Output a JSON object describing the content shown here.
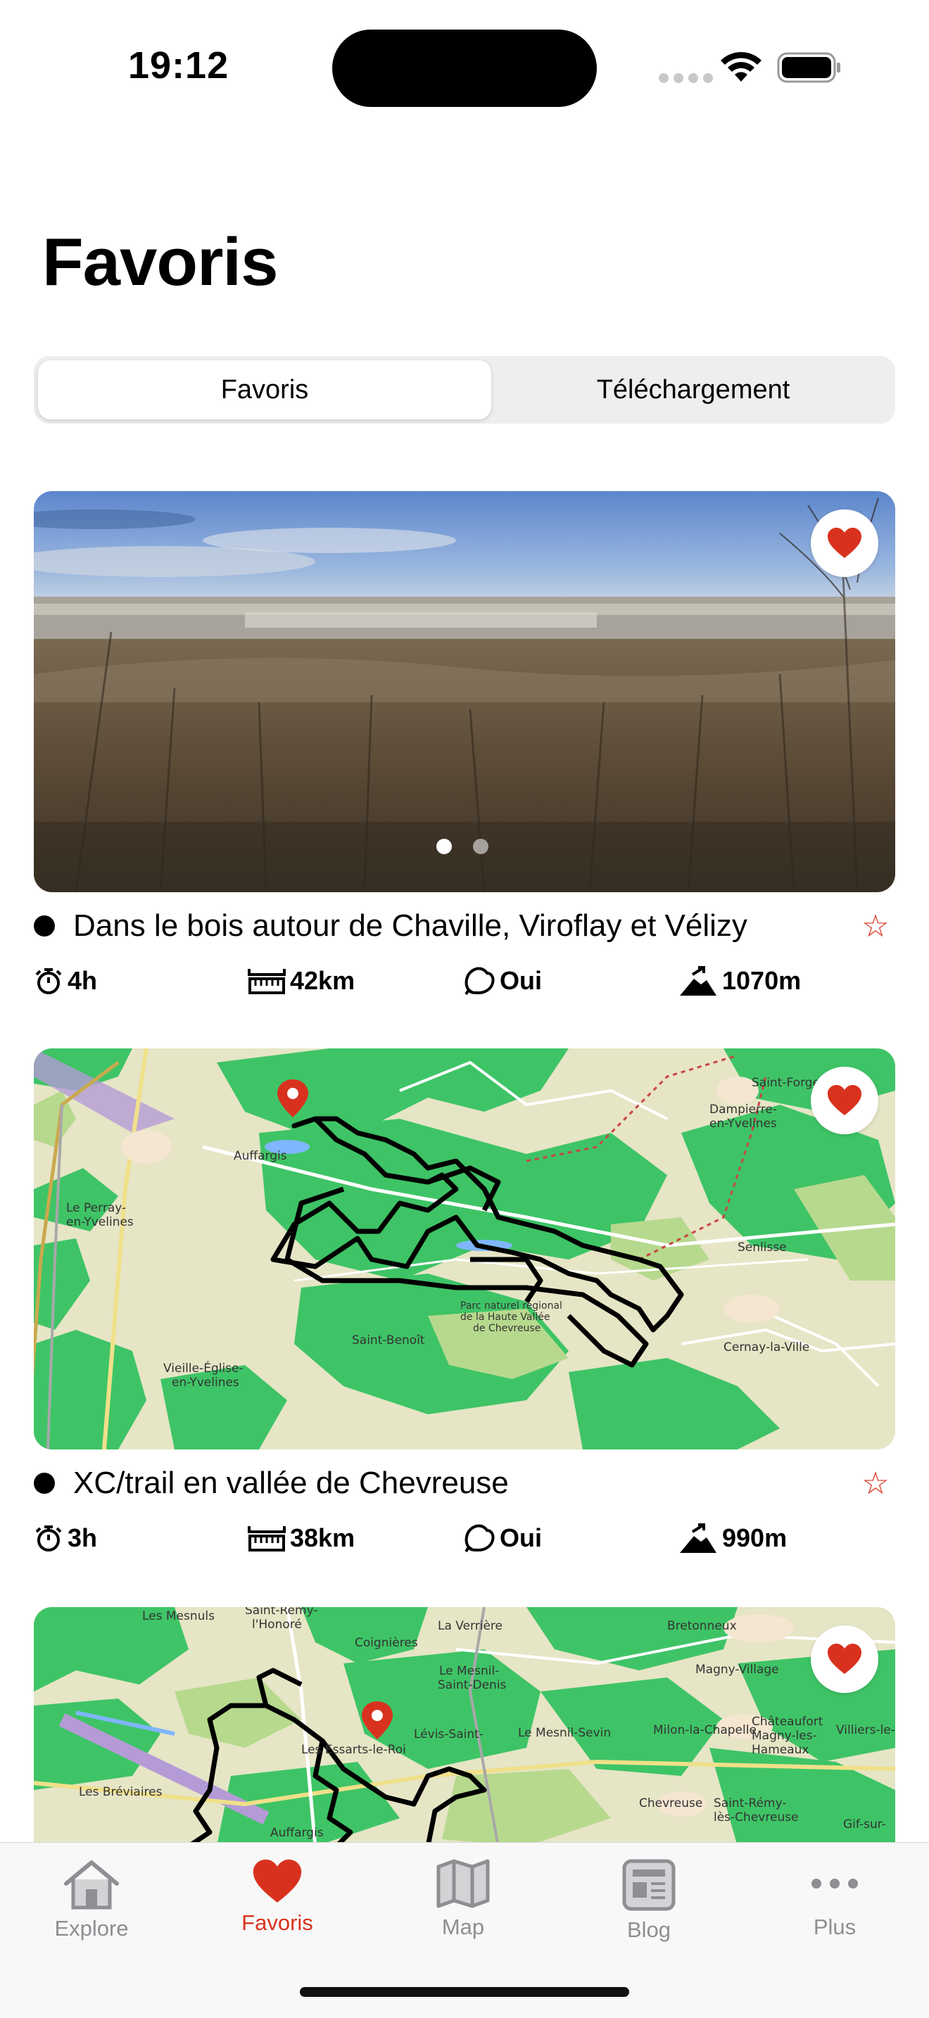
{
  "status_bar": {
    "time": "19:12"
  },
  "page": {
    "title": "Favoris"
  },
  "segmented": {
    "tabs": [
      "Favoris",
      "Téléchargement"
    ],
    "selected": "Favoris"
  },
  "colors": {
    "accent": "#d8321e",
    "forest": "#3ec466",
    "field": "#e6e5c6"
  },
  "cards": [
    {
      "title": "Dans le bois autour de Chaville, Viroflay et Vélizy",
      "image": "landscape-photo",
      "favorite": true,
      "stats": {
        "duration": "4h",
        "distance": "42km",
        "loop": "Oui",
        "elevation": "1070m"
      }
    },
    {
      "title": "XC/trail en vallée de Chevreuse",
      "image": "trail-map",
      "favorite": true,
      "map_labels": [
        "Auffargis",
        "Le Perray-en-Yvelines",
        "Saint-Benoît",
        "Vieille-Église-en-Yvelines",
        "Parc naturel régional de la Haute Vallée de Chevreuse",
        "Cernay-la-Ville",
        "Senlisse",
        "Dampierre-en-Yvelines",
        "Saint-Forget"
      ],
      "stats": {
        "duration": "3h",
        "distance": "38km",
        "loop": "Oui",
        "elevation": "990m"
      }
    },
    {
      "title": "",
      "image": "trail-map",
      "favorite": true,
      "map_labels": [
        "Les Mesnuls",
        "Saint-Rémy-l'Honoré",
        "Coignières",
        "La Verrière",
        "Le Mesnil-Saint-Denis",
        "Lévis-Saint-Nom",
        "Le Mesnil-Sevin",
        "Les Essarts-le-Roi",
        "Les Bréviaires",
        "Auffargis",
        "Bretonneux",
        "Magny-Village",
        "Magny-les-Hameaux",
        "Châteaufort",
        "Milon-la-Chapelle",
        "Chevreuse",
        "Saint-Rémy-lès-Chevreuse",
        "Villiers-le-Bâcle",
        "Gif-sur-Yvette"
      ]
    }
  ],
  "tab_bar": {
    "items": [
      {
        "label": "Explore",
        "icon": "house-icon"
      },
      {
        "label": "Favoris",
        "icon": "heart-icon",
        "active": true
      },
      {
        "label": "Map",
        "icon": "map-icon"
      },
      {
        "label": "Blog",
        "icon": "newspaper-icon"
      },
      {
        "label": "Plus",
        "icon": "more-icon"
      }
    ]
  }
}
